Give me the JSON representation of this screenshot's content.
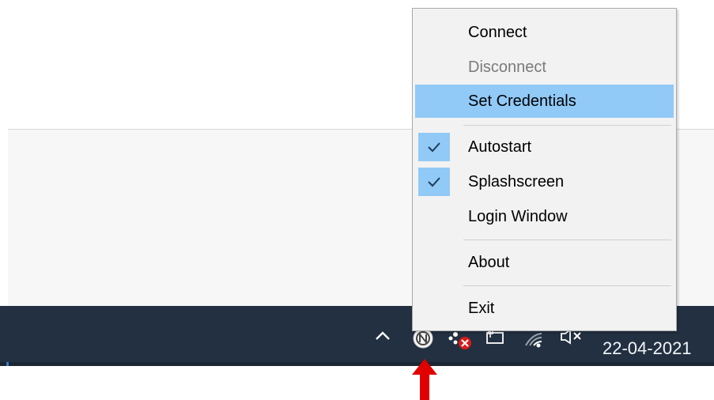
{
  "menu": {
    "items": [
      {
        "label": "Connect",
        "enabled": true,
        "selected": false,
        "checked": false
      },
      {
        "label": "Disconnect",
        "enabled": false,
        "selected": false,
        "checked": false
      },
      {
        "label": "Set Credentials",
        "enabled": true,
        "selected": true,
        "checked": false
      },
      {
        "label": "Autostart",
        "enabled": true,
        "selected": false,
        "checked": true
      },
      {
        "label": "Splashscreen",
        "enabled": true,
        "selected": false,
        "checked": true
      },
      {
        "label": "Login Window",
        "enabled": true,
        "selected": false,
        "checked": false
      },
      {
        "label": "About",
        "enabled": true,
        "selected": false,
        "checked": false
      },
      {
        "label": "Exit",
        "enabled": true,
        "selected": false,
        "checked": false
      }
    ]
  },
  "taskbar": {
    "date": "22-04-2021",
    "tray_icons": [
      "chevron-up-icon",
      "app-tray-icon",
      "network-error-icon",
      "battery-icon",
      "wifi-icon",
      "volume-mute-icon"
    ]
  },
  "annotation": {
    "arrow_color": "#e00000"
  },
  "colors": {
    "selection": "#91c9f7",
    "taskbar": "#223041",
    "menu_background": "#f2f2f2"
  }
}
